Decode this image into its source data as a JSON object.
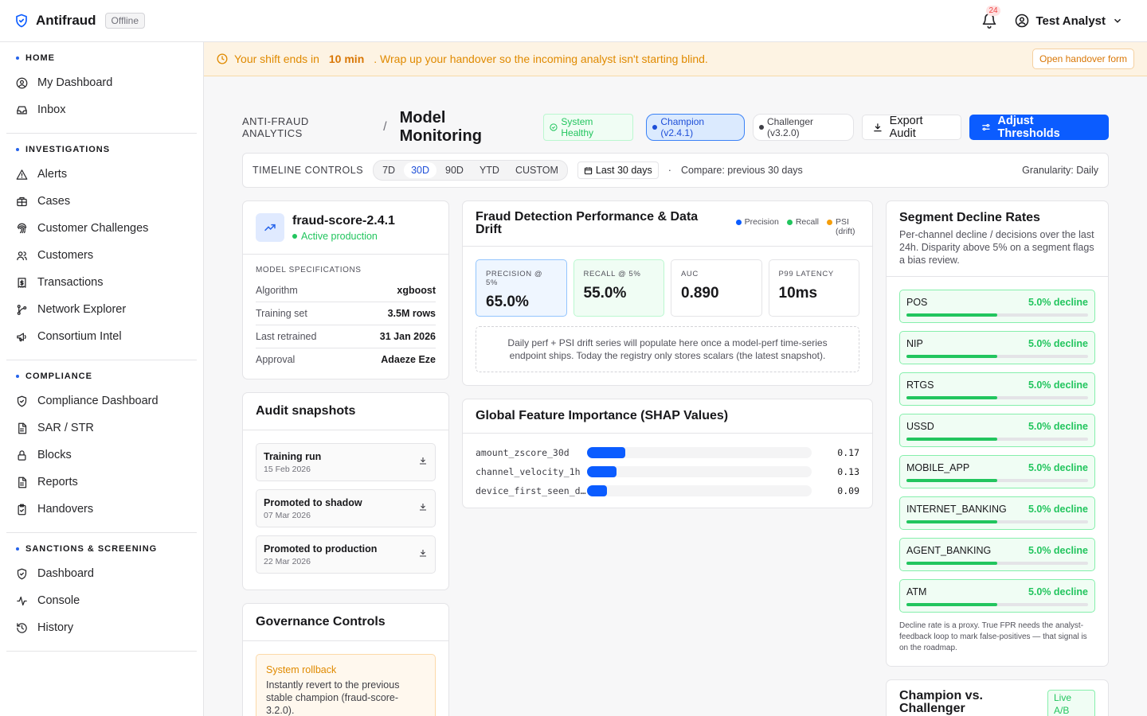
{
  "app": {
    "name": "Antifraud",
    "status": "Offline"
  },
  "topbar": {
    "notification_count": "24",
    "user_name": "Test Analyst"
  },
  "sidebar": {
    "sections": [
      {
        "title": "HOME",
        "items": [
          {
            "label": "My Dashboard",
            "icon": "user-circle-icon"
          },
          {
            "label": "Inbox",
            "icon": "inbox-icon"
          }
        ]
      },
      {
        "title": "INVESTIGATIONS",
        "items": [
          {
            "label": "Alerts",
            "icon": "alert-triangle-icon"
          },
          {
            "label": "Cases",
            "icon": "briefcase-icon"
          },
          {
            "label": "Customer Challenges",
            "icon": "fingerprint-icon"
          },
          {
            "label": "Customers",
            "icon": "users-icon"
          },
          {
            "label": "Transactions",
            "icon": "receipt-icon"
          },
          {
            "label": "Network Explorer",
            "icon": "network-icon"
          },
          {
            "label": "Consortium Intel",
            "icon": "megaphone-icon"
          }
        ]
      },
      {
        "title": "COMPLIANCE",
        "items": [
          {
            "label": "Compliance Dashboard",
            "icon": "shield-check-icon"
          },
          {
            "label": "SAR / STR",
            "icon": "file-text-icon"
          },
          {
            "label": "Blocks",
            "icon": "lock-icon"
          },
          {
            "label": "Reports",
            "icon": "file-text-icon"
          },
          {
            "label": "Handovers",
            "icon": "clipboard-check-icon"
          }
        ]
      },
      {
        "title": "SANCTIONS & SCREENING",
        "items": [
          {
            "label": "Dashboard",
            "icon": "shield-check-icon"
          },
          {
            "label": "Console",
            "icon": "activity-icon"
          },
          {
            "label": "History",
            "icon": "history-icon"
          }
        ]
      }
    ]
  },
  "banner": {
    "prefix": "Your shift ends in",
    "time": "10 min",
    "suffix": ". Wrap up your handover so the incoming analyst isn't starting blind.",
    "button": "Open handover form"
  },
  "header": {
    "breadcrumb": "ANTI-FRAUD ANALYTICS",
    "separator": "/",
    "title": "Model Monitoring",
    "health": "System Healthy",
    "champion": "Champion (v2.4.1)",
    "challenger": "Challenger (v3.2.0)",
    "export_label": "Export Audit",
    "adjust_label": "Adjust Thresholds"
  },
  "timeline": {
    "label": "TIMELINE CONTROLS",
    "ranges": [
      "7D",
      "30D",
      "90D",
      "YTD",
      "CUSTOM"
    ],
    "selected": "30D",
    "date_range": "Last 30 days",
    "dot": "·",
    "compare": "Compare: previous 30 days",
    "granularity": "Granularity: Daily"
  },
  "model": {
    "name": "fraud-score-2.4.1",
    "status": "Active production",
    "specs_label": "MODEL SPECIFICATIONS",
    "specs": [
      {
        "k": "Algorithm",
        "v": "xgboost"
      },
      {
        "k": "Training set",
        "v": "3.5M rows"
      },
      {
        "k": "Last retrained",
        "v": "31 Jan 2026"
      },
      {
        "k": "Approval",
        "v": "Adaeze Eze"
      }
    ]
  },
  "audit": {
    "title": "Audit snapshots",
    "items": [
      {
        "title": "Training run",
        "date": "15 Feb 2026"
      },
      {
        "title": "Promoted to shadow",
        "date": "07 Mar 2026"
      },
      {
        "title": "Promoted to production",
        "date": "22 Mar 2026"
      }
    ]
  },
  "governance": {
    "title": "Governance Controls",
    "rollback_title": "System rollback",
    "rollback_desc": "Instantly revert to the previous stable champion (fraud-score-3.2.0)."
  },
  "performance": {
    "title": "Fraud Detection Performance & Data Drift",
    "legend": [
      {
        "label": "Precision",
        "color": "#0b5cff"
      },
      {
        "label": "Recall",
        "color": "#22c55e"
      },
      {
        "label": "PSI (drift)",
        "color": "#f59e0b"
      }
    ],
    "metrics": [
      {
        "label": "PRECISION @ 5%",
        "value": "65.0%"
      },
      {
        "label": "RECALL @ 5%",
        "value": "55.0%"
      },
      {
        "label": "AUC",
        "value": "0.890"
      },
      {
        "label": "P99 LATENCY",
        "value": "10ms"
      }
    ],
    "note": "Daily perf + PSI drift series will populate here once a model-perf time-series endpoint ships. Today the registry only stores scalars (the latest snapshot)."
  },
  "shap": {
    "title": "Global Feature Importance (SHAP Values)",
    "features": [
      {
        "name": "amount_zscore_30d",
        "value": 0.17,
        "label": "0.17"
      },
      {
        "name": "channel_velocity_1h",
        "value": 0.13,
        "label": "0.13"
      },
      {
        "name": "device_first_seen_days",
        "value": 0.09,
        "label": "0.09"
      }
    ]
  },
  "segments": {
    "title": "Segment Decline Rates",
    "subtitle": "Per-channel decline / decisions over the last 24h. Disparity above 5% on a segment flags a bias review.",
    "items": [
      {
        "name": "POS",
        "label": "5.0% decline",
        "rate": 0.5
      },
      {
        "name": "NIP",
        "label": "5.0% decline",
        "rate": 0.5
      },
      {
        "name": "RTGS",
        "label": "5.0% decline",
        "rate": 0.5
      },
      {
        "name": "USSD",
        "label": "5.0% decline",
        "rate": 0.5
      },
      {
        "name": "MOBILE_APP",
        "label": "5.0% decline",
        "rate": 0.5
      },
      {
        "name": "INTERNET_BANKING",
        "label": "5.0% decline",
        "rate": 0.5
      },
      {
        "name": "AGENT_BANKING",
        "label": "5.0% decline",
        "rate": 0.5
      },
      {
        "name": "ATM",
        "label": "5.0% decline",
        "rate": 0.5
      }
    ],
    "note": "Decline rate is a proxy. True FPR needs the analyst-feedback loop to mark false-positives — that signal is on the roadmap."
  },
  "champion_card": {
    "title": "Champion vs. Challenger",
    "badge": "Live A/B"
  },
  "colors": {
    "accent": "#0b5cff",
    "success": "#22c55e",
    "warning": "#e08a00"
  }
}
